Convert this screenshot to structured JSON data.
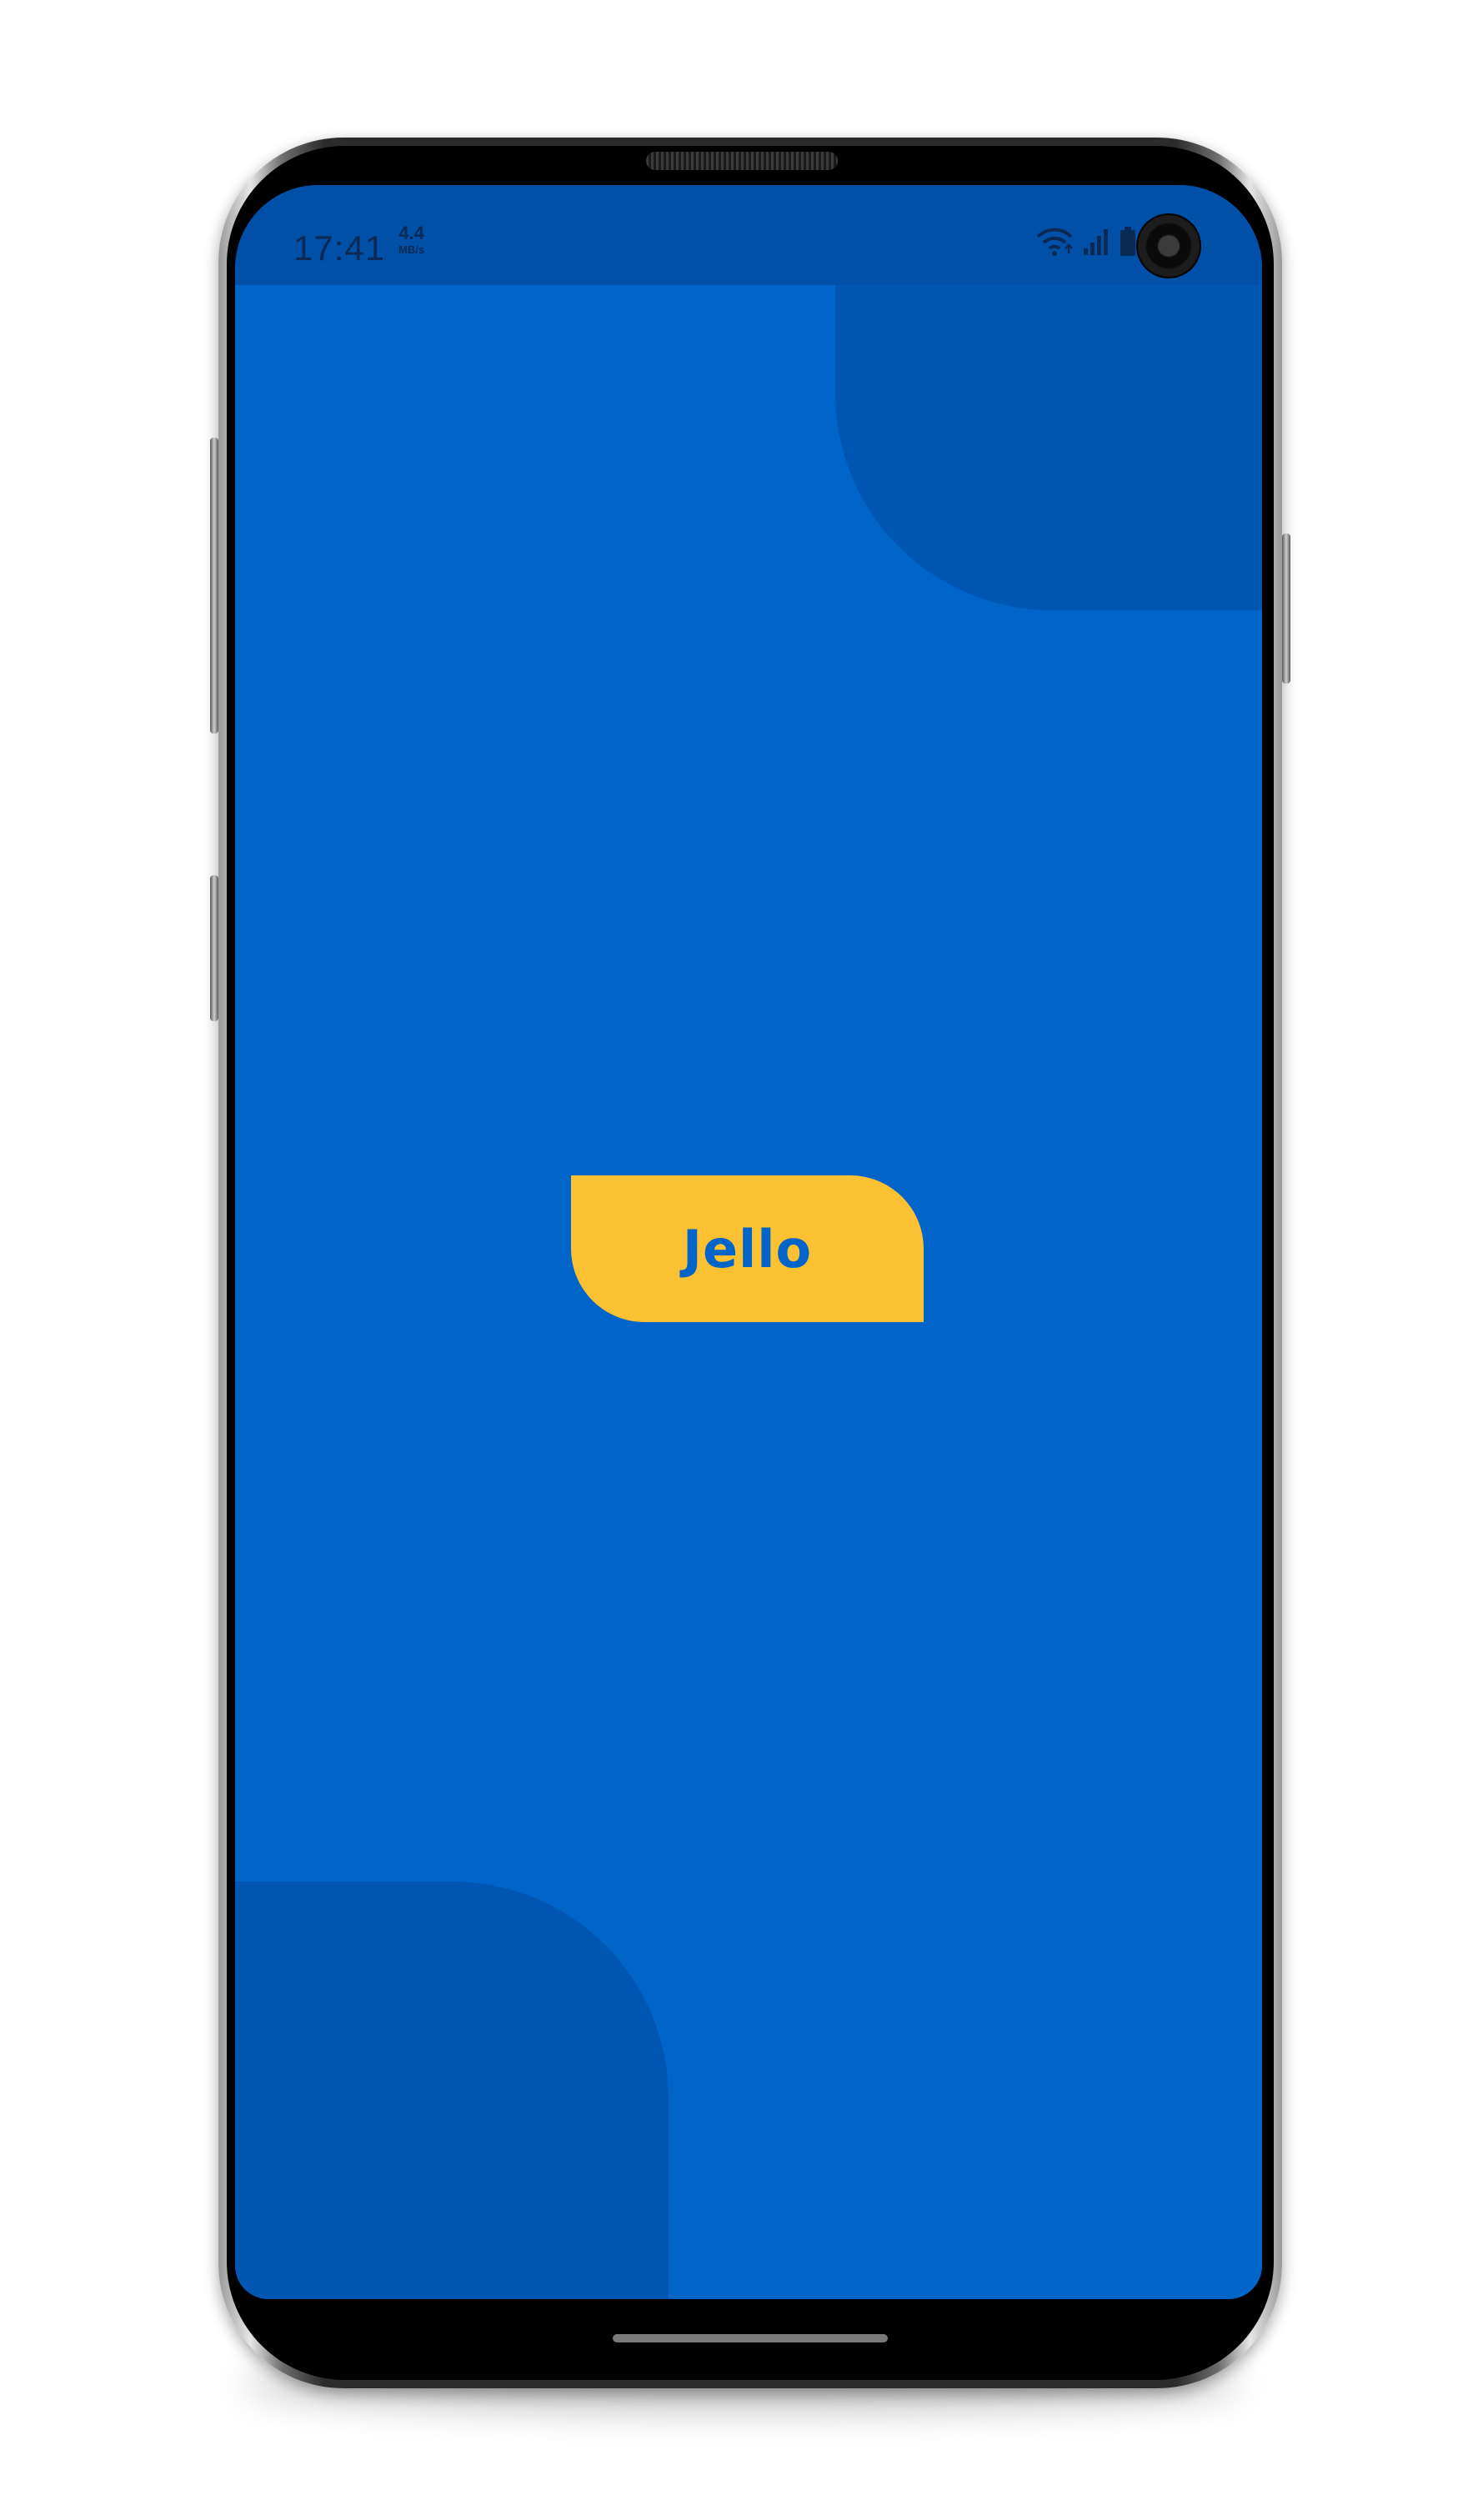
{
  "status_bar": {
    "time": "17:41",
    "speed_value": "4.4",
    "speed_unit": "MB/s",
    "icons": [
      "wifi-icon",
      "signal-icon",
      "battery-icon"
    ]
  },
  "splash": {
    "logo_text": "Jello"
  },
  "colors": {
    "background": "#0064c8",
    "status_bar": "#0050a8",
    "decoration": "#0056b0",
    "logo_fill": "#fcc132",
    "logo_text": "#0064c8"
  }
}
